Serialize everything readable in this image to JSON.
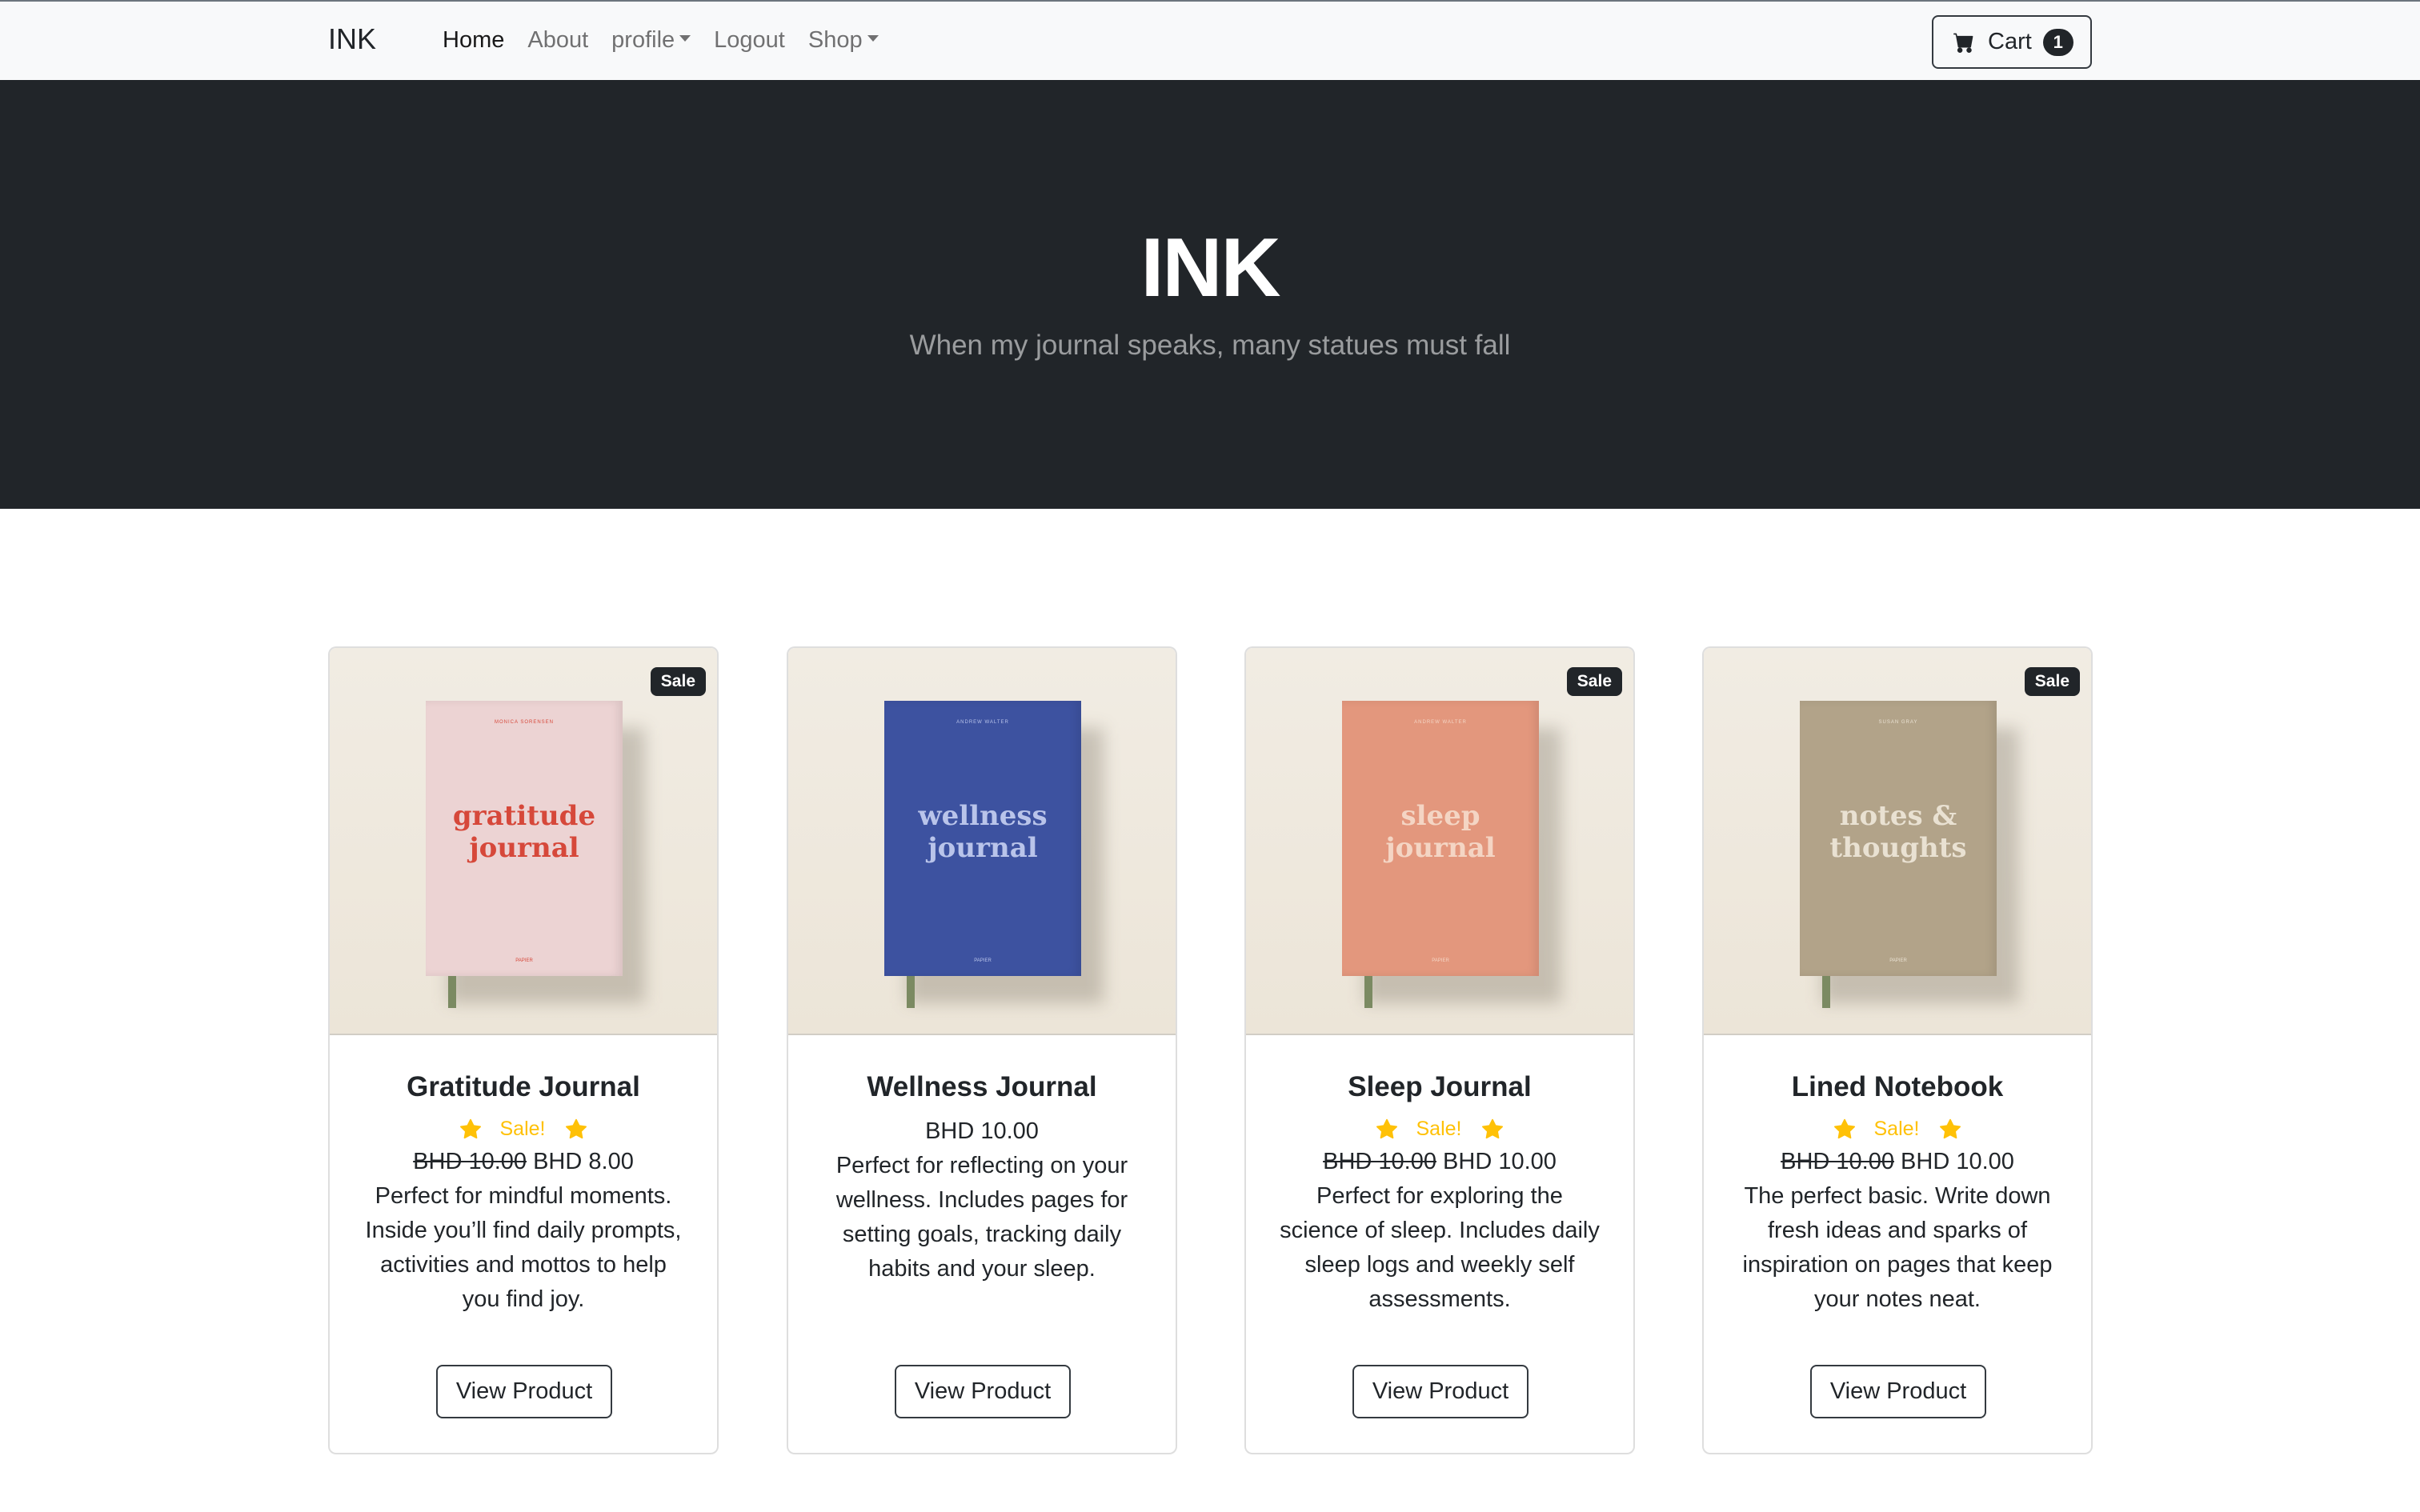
{
  "navbar": {
    "brand": "INK",
    "links": [
      {
        "label": "Home",
        "active": true
      },
      {
        "label": "About",
        "active": false
      },
      {
        "label": "profile",
        "dropdown": true
      },
      {
        "label": "Logout",
        "active": false
      },
      {
        "label": "Shop",
        "dropdown": true
      }
    ],
    "cart": {
      "label": "Cart",
      "count": "1",
      "icon": "cart-icon"
    }
  },
  "hero": {
    "title": "INK",
    "subtitle": "When my journal speaks, many statues must fall"
  },
  "products": [
    {
      "name": "Gratitude Journal",
      "sale_badge": "Sale",
      "on_sale": true,
      "sale_text": "Sale!",
      "old_price": "BHD 10.00",
      "price": "BHD 8.00",
      "description": "Perfect for mindful moments. Inside you’ll find daily prompts, activities and mottos to help you find joy.",
      "button": "View Product",
      "cover": {
        "title_line1": "gratitude",
        "title_line2": "journal",
        "color": "#ecd3d3",
        "text_color": "#d6483a"
      }
    },
    {
      "name": "Wellness Journal",
      "sale_badge": "",
      "on_sale": false,
      "sale_text": "",
      "old_price": "",
      "price": "BHD 10.00",
      "description": "Perfect for reflecting on your wellness. Includes pages for setting goals, tracking daily habits and your sleep.",
      "button": "View Product",
      "cover": {
        "title_line1": "wellness",
        "title_line2": "journal",
        "color": "#3d52a0",
        "text_color": "#b9c4ea"
      }
    },
    {
      "name": "Sleep Journal",
      "sale_badge": "Sale",
      "on_sale": true,
      "sale_text": "Sale!",
      "old_price": "BHD 10.00",
      "price": "BHD 10.00",
      "description": "Perfect for exploring the science of sleep. Includes daily sleep logs and weekly self assessments.",
      "button": "View Product",
      "cover": {
        "title_line1": "sleep",
        "title_line2": "journal",
        "color": "#e3977d",
        "text_color": "#f4d5c4"
      }
    },
    {
      "name": "Lined Notebook",
      "sale_badge": "Sale",
      "on_sale": true,
      "sale_text": "Sale!",
      "old_price": "BHD 10.00",
      "price": "BHD 10.00",
      "description": "The perfect basic. Write down fresh ideas and sparks of inspiration on pages that keep your notes neat.",
      "button": "View Product",
      "cover": {
        "title_line1": "notes &",
        "title_line2": "thoughts",
        "color": "#b2a389",
        "text_color": "#e9e1d2"
      }
    }
  ],
  "colors": {
    "star": "#ffc107",
    "dark": "#212529",
    "navbar_bg": "#f8f9fa"
  }
}
